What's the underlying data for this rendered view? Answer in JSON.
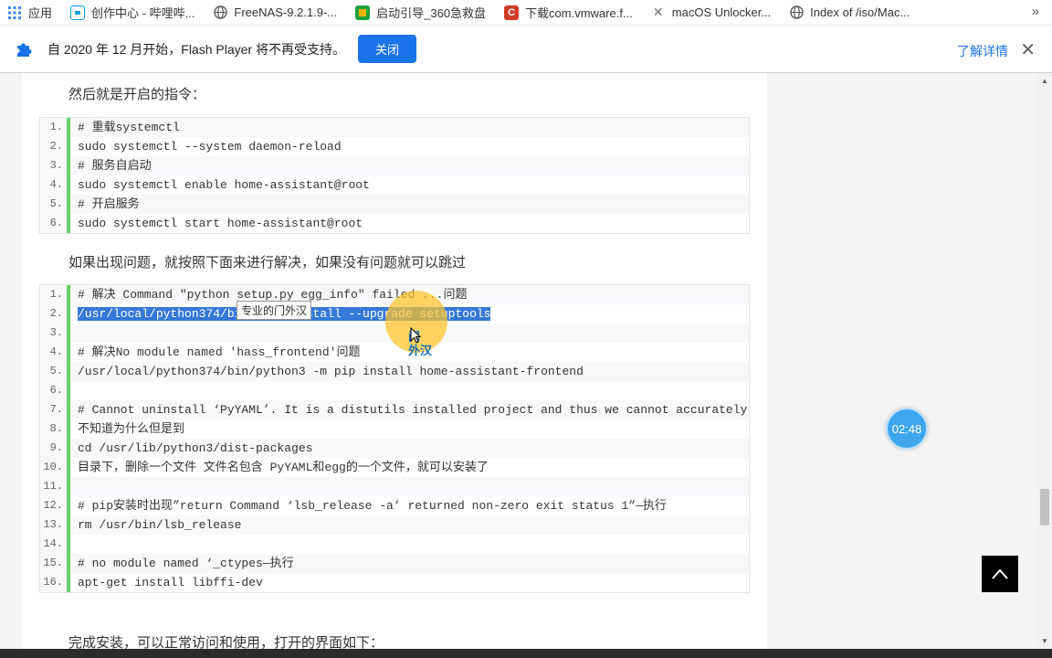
{
  "bookmarks": [
    {
      "label": "应用",
      "icon": "apps-grid-icon"
    },
    {
      "label": "创作中心 - 哔哩哔...",
      "icon": "bilibili-icon"
    },
    {
      "label": "FreeNAS-9.2.1.9-...",
      "icon": "globe-icon"
    },
    {
      "label": "启动引导_360急救盘",
      "icon": "360-icon"
    },
    {
      "label": "下载com.vmware.f...",
      "icon": "csdn-icon"
    },
    {
      "label": "macOS Unlocker...",
      "icon": "x-logo-icon"
    },
    {
      "label": "Index of /iso/Mac...",
      "icon": "globe-icon"
    }
  ],
  "bookmarks_more": "»",
  "infobar": {
    "message": "自 2020 年 12 月开始，Flash Player 将不再受支持。",
    "close_label": "关闭",
    "learn_more": "了解详情",
    "dismiss": "✕"
  },
  "article": {
    "para1": "然后就是开启的指令：",
    "para2": "如果出现问题，就按照下面来进行解决，如果没有问题就可以跳过",
    "para3": "完成安装，可以正常访问和使用，打开的界面如下：",
    "block1": [
      {
        "n": "1.",
        "text": "# 重载systemctl"
      },
      {
        "n": "2.",
        "text": "sudo systemctl --system daemon-reload"
      },
      {
        "n": "3.",
        "text": "# 服务自启动"
      },
      {
        "n": "4.",
        "text": "sudo systemctl enable home-assistant@root"
      },
      {
        "n": "5.",
        "text": "# 开启服务"
      },
      {
        "n": "6.",
        "text": "sudo systemctl start home-assistant@root"
      }
    ],
    "block2": [
      {
        "n": "1.",
        "text": "# 解决 Command \"python setup.py egg_info\" failed ...问题"
      },
      {
        "n": "2.",
        "text": "/usr/local/python374/bin/pip3 install --upgrade setuptools"
      },
      {
        "n": "3.",
        "text": ""
      },
      {
        "n": "4.",
        "text": "# 解决No module named 'hass_frontend'问题"
      },
      {
        "n": "5.",
        "text": "/usr/local/python374/bin/python3 -m pip install home-assistant-frontend"
      },
      {
        "n": "6.",
        "text": ""
      },
      {
        "n": "7.",
        "text": "# Cannot uninstall ‘PyYAML’. It is a distutils installed project and thus we cannot accurately"
      },
      {
        "n": "8.",
        "text": "不知道为什么但是到"
      },
      {
        "n": "9.",
        "text": "cd /usr/lib/python3/dist-packages"
      },
      {
        "n": "10.",
        "text": "目录下，删除一个文件 文件名包含 PyYAML和egg的一个文件，就可以安装了"
      },
      {
        "n": "11.",
        "text": ""
      },
      {
        "n": "12.",
        "text": "# pip安装时出现”return Command ‘lsb_release -a’ returned non-zero exit status 1”—执行"
      },
      {
        "n": "13.",
        "text": "rm /usr/bin/lsb_release"
      },
      {
        "n": "14.",
        "text": ""
      },
      {
        "n": "15.",
        "text": "# no module named ‘_ctypes—执行"
      },
      {
        "n": "16.",
        "text": "apt-get install libffi-dev"
      }
    ]
  },
  "tooltip": "专业的门外汉",
  "halo_label_line1": "门",
  "halo_label_line2": "外汉",
  "timer": "02:48",
  "colors": {
    "accent": "#1a73e8",
    "code_bar": "#6ccf6c",
    "selection": "#3579d9",
    "timer": "#3fa6ee"
  }
}
